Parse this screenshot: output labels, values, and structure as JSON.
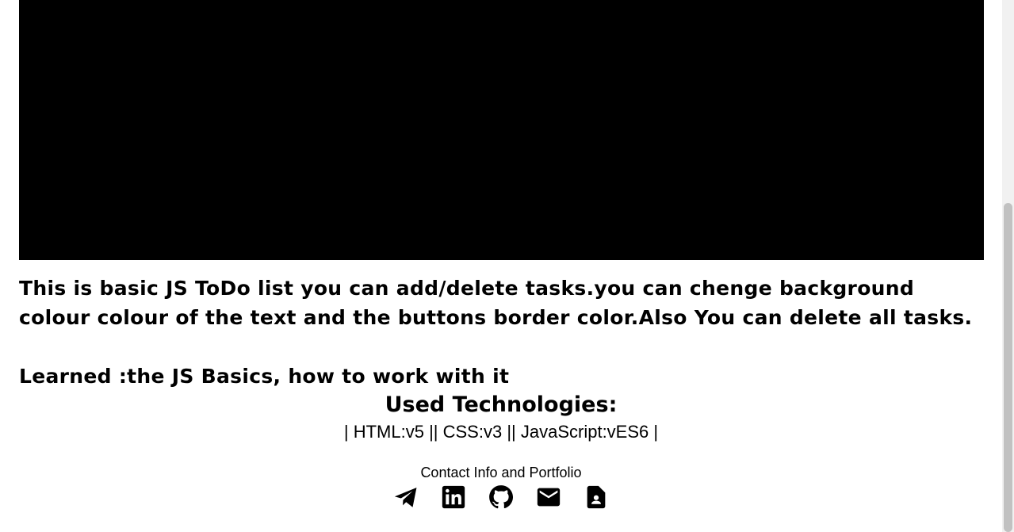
{
  "project": {
    "description": "This is basic JS ToDo list you can add/delete tasks.you can chenge background colour colour of the text and the buttons border color.Also You can delete all tasks.",
    "learned": "Learned :the JS Basics, how to work with it"
  },
  "technologies": {
    "title": "Used Technologies:",
    "list": "| HTML:v5 || CSS:v3 || JavaScript:vES6 |"
  },
  "contact": {
    "title": "Contact Info and Portfolio",
    "links": [
      {
        "icon": "telegram-icon"
      },
      {
        "icon": "linkedin-icon"
      },
      {
        "icon": "github-icon"
      },
      {
        "icon": "email-icon"
      },
      {
        "icon": "resume-icon"
      }
    ]
  }
}
